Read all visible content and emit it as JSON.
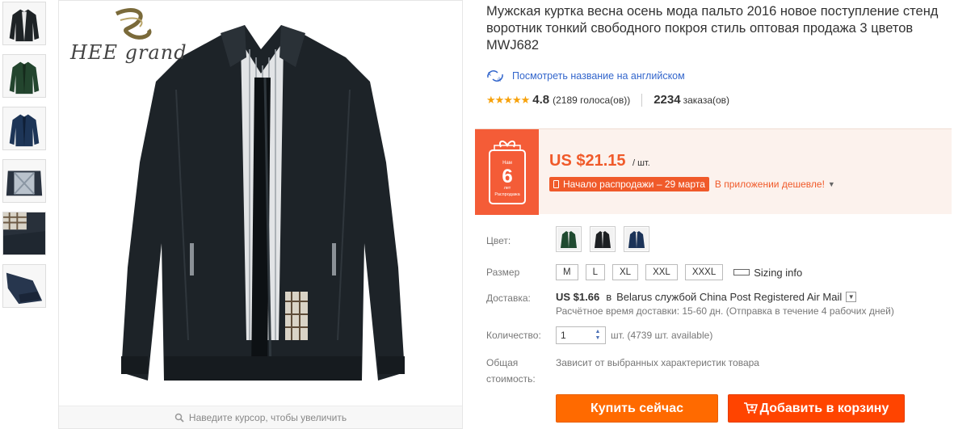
{
  "thumbnails": [
    {
      "color": "#1e2326",
      "name": "thumb-black"
    },
    {
      "color": "#23452e",
      "name": "thumb-green"
    },
    {
      "color": "#1d3557",
      "name": "thumb-navy"
    },
    {
      "color": "#2a3340",
      "name": "thumb-inside"
    },
    {
      "color": "#28303a",
      "name": "thumb-detail-lining"
    },
    {
      "color": "#27364e",
      "name": "thumb-detail-cuff"
    }
  ],
  "gallery": {
    "brand_text": "HEE grand",
    "zoom_hint": "Наведите курсор, чтобы увеличить"
  },
  "product": {
    "title": "Мужская куртка весна осень мода пальто 2016 новое поступление стенд воротник тонкий свободного покроя стиль оптовая продажа 3 цветов MWJ682",
    "translate_link": "Посмотреть название на английском",
    "stars": "★★★★★",
    "rating": "4.8",
    "votes": "(2189 голоса(ов))",
    "orders_count": "2234",
    "orders_label": "заказа(ов)"
  },
  "price": {
    "amount": "US $21.15",
    "unit": "/ шт.",
    "sale_start": "Начало распродажи – 29 марта",
    "app_cheaper": "В приложении дешевле!",
    "promo_top": "Нам",
    "promo_number": "6",
    "promo_years": "лет",
    "promo_bottom": "Распродажа"
  },
  "options": {
    "color_label": "Цвет:",
    "colors": [
      {
        "name": "green",
        "hex": "#1f4a30"
      },
      {
        "name": "black",
        "hex": "#1c1f22"
      },
      {
        "name": "navy",
        "hex": "#1b3358"
      }
    ],
    "size_label": "Размер",
    "sizes": [
      "M",
      "L",
      "XL",
      "XXL",
      "XXXL"
    ],
    "sizing_info": "Sizing info"
  },
  "shipping": {
    "label": "Доставка:",
    "price": "US $1.66",
    "in_word": "в",
    "method": "Belarus службой China Post Registered Air Mail",
    "estimate": "Расчётное время доставки: 15-60 дн. (Отправка в течение 4 рабочих дней)"
  },
  "quantity": {
    "label": "Количество:",
    "value": "1",
    "available": "шт. (4739 шт. available)"
  },
  "total": {
    "label_line1": "Общая",
    "label_line2": "стоимость:",
    "note": "Зависит от выбранных характеристик товара"
  },
  "actions": {
    "buy_now": "Купить сейчас",
    "add_to_cart": "Добавить в корзину"
  },
  "colors": {
    "accent": "#ff6a00",
    "cart": "#ff4400",
    "price": "#f05a2a",
    "link": "#3366cc",
    "star": "#f7a20c",
    "price_bg": "#fcf2ed"
  }
}
